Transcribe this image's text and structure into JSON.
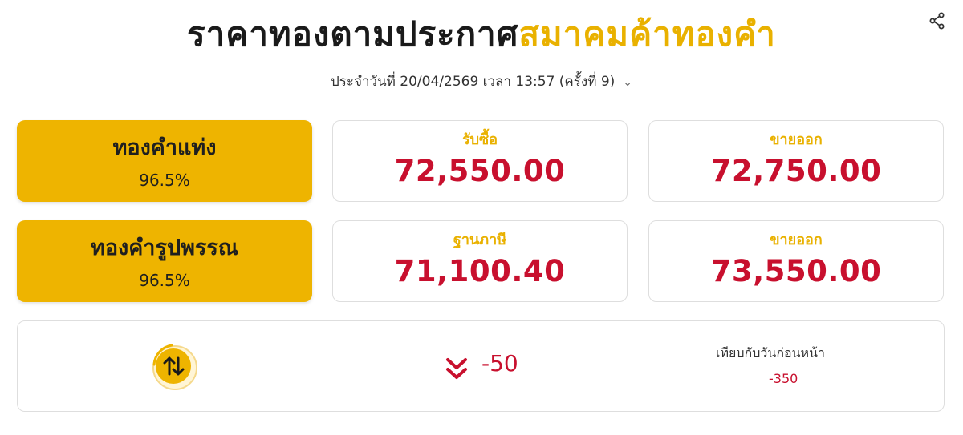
{
  "header": {
    "title_main": "ราคาทองตามประกาศ",
    "title_accent": "สมาคมค้าทองคำ",
    "share_icon": "share-icon",
    "date_line": "ประจำวันที่ 20/04/2569 เวลา 13:57 (ครั้งที่ 9)",
    "dropdown_icon": "chevron-down-icon"
  },
  "gold_bar": {
    "name": "ทองคำแท่ง",
    "purity": "96.5%",
    "buy_label": "รับซื้อ",
    "buy_price": "72,550.00",
    "sell_label": "ขายออก",
    "sell_price": "72,750.00"
  },
  "gold_ornament": {
    "name": "ทองคำรูปพรรณ",
    "purity": "96.5%",
    "base_label": "ฐานภาษี",
    "base_price": "71,100.40",
    "sell_label": "ขายออก",
    "sell_price": "73,550.00"
  },
  "change": {
    "icon": "up-down-arrows-icon",
    "direction_icon": "double-chevron-down-icon",
    "value": "-50",
    "compare_label": "เทียบกับวันก่อนหน้า",
    "compare_value": "-350"
  },
  "colors": {
    "accent": "#eeb400",
    "price_red": "#c8102e"
  }
}
